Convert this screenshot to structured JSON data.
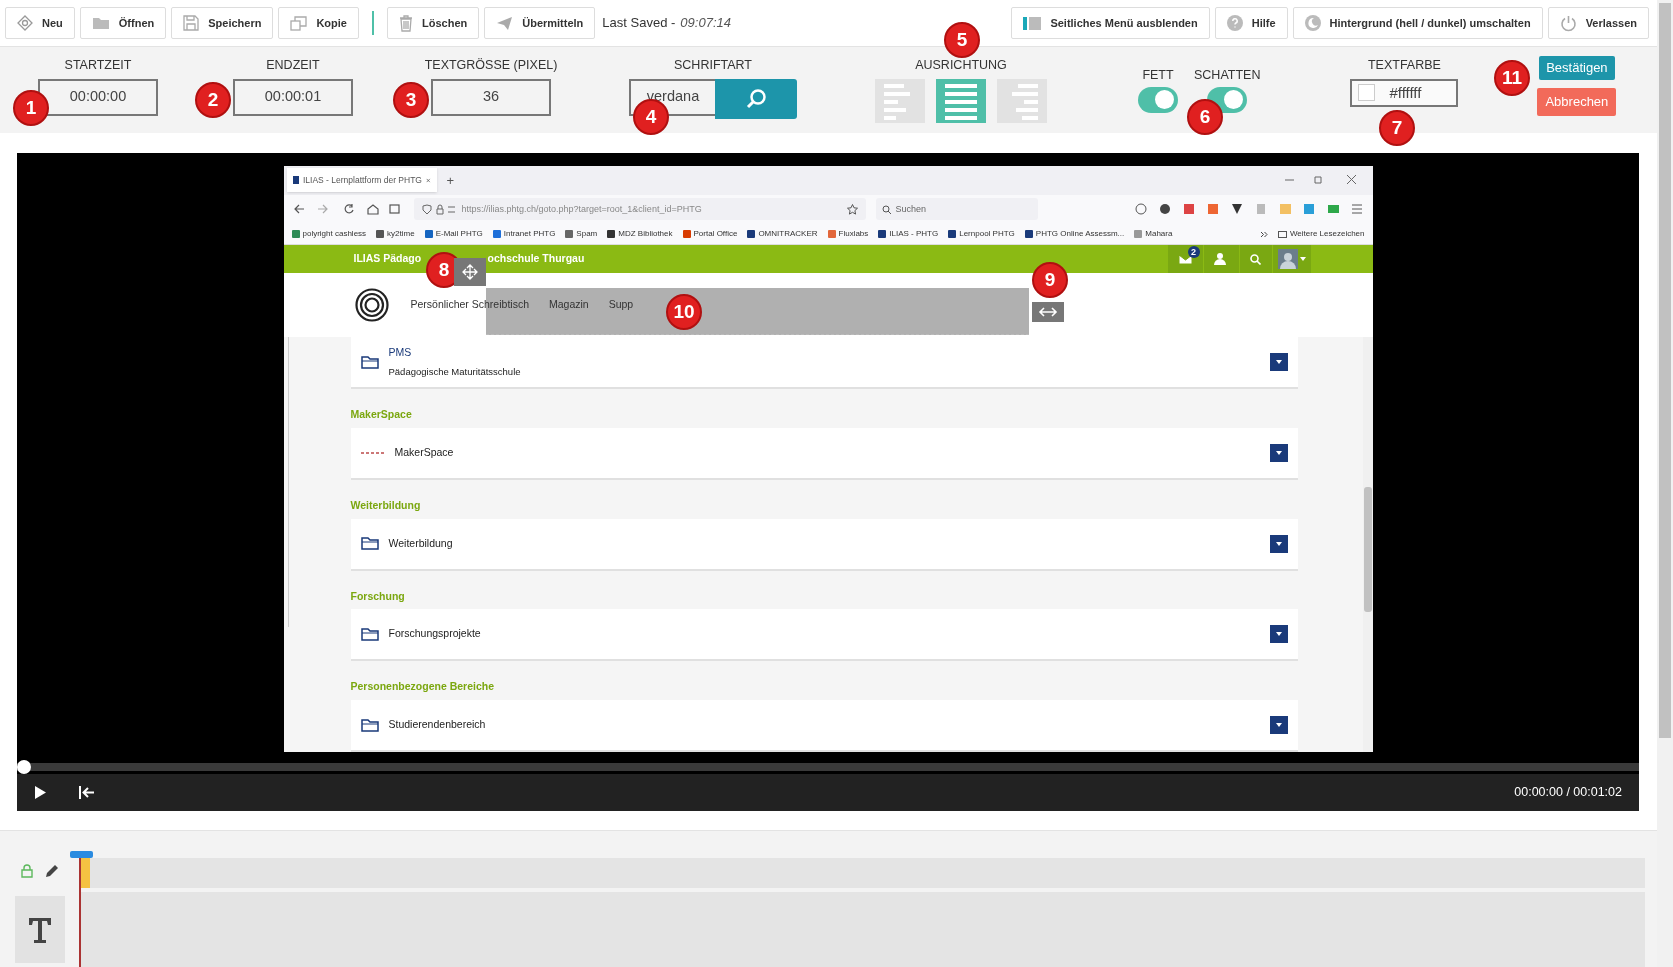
{
  "toolbar": {
    "left_buttons": [
      {
        "label": "Neu"
      },
      {
        "label": "Öffnen"
      },
      {
        "label": "Speichern"
      },
      {
        "label": "Kopie"
      }
    ],
    "edit_buttons": [
      {
        "label": "Löschen"
      },
      {
        "label": "Übermitteln"
      }
    ],
    "last_saved": {
      "label": "Last Saved -",
      "time": "09:07:14"
    },
    "right_buttons": [
      {
        "label": "Seitliches Menü ausblenden"
      },
      {
        "label": "Hilfe"
      },
      {
        "label": "Hintergrund (hell / dunkel) umschalten"
      },
      {
        "label": "Verlassen"
      }
    ]
  },
  "settings": {
    "fields": [
      {
        "label": "STARTZEIT",
        "value": "00:00:00"
      },
      {
        "label": "ENDZEIT",
        "value": "00:00:01"
      },
      {
        "label": "TEXTGRÖSSE (PIXEL)",
        "value": "36"
      }
    ],
    "font": {
      "label": "SCHRIFTART",
      "value": "verdana"
    },
    "alignment": {
      "label": "AUSRICHTUNG",
      "options": [
        {
          "kind": "left",
          "selected": false
        },
        {
          "kind": "justify",
          "selected": true
        },
        {
          "kind": "right",
          "selected": false
        }
      ]
    },
    "toggles": [
      {
        "label": "FETT",
        "on": true
      },
      {
        "label": "SCHATTEN",
        "on": true
      }
    ],
    "text_color": {
      "label": "TEXTFARBE",
      "value": "#ffffff",
      "color": "#ffffff"
    },
    "confirm": "Bestätigen",
    "cancel": "Abbrechen"
  },
  "video": {
    "browser": {
      "tab": "ILIAS - Lernplattform der PHTG",
      "new_tab": "+",
      "url": "https://ilias.phtg.ch/goto.php?target=root_1&client_id=PHTG",
      "search": "Suchen",
      "bookmarks": [
        "polyright cashless",
        "ky2time",
        "E-Mail PHTG",
        "Intranet PHTG",
        "Spam",
        "MDZ Bibliothek",
        "Portal Office",
        "OMNITRACKER",
        "Fluxlabs",
        "ILIAS - PHTG",
        "Lernpool PHTG",
        "PHTG Online Assessm...",
        "Mahara"
      ],
      "more_bookmarks": "Weitere Lesezeichen",
      "site_title": [
        "ILIAS Pädago",
        "ochschule Thurgau"
      ],
      "mail_count": "2",
      "nav": [
        "Persönlicher Schreibtisch",
        "Magazin",
        "Supp"
      ],
      "sections": [
        {
          "items": [
            {
              "title": "PMS",
              "subtitle": "Pädagogische Maturitätsschule"
            }
          ]
        },
        {
          "heading": "MakerSpace",
          "items": [
            {
              "title": "MakerSpace"
            }
          ]
        },
        {
          "heading": "Weiterbildung",
          "items": [
            {
              "title": "Weiterbildung"
            }
          ]
        },
        {
          "heading": "Forschung",
          "items": [
            {
              "title": "Forschungsprojekte"
            }
          ]
        },
        {
          "heading": "Personenbezogene Bereiche",
          "items": [
            {
              "title": "Studierendenbereich"
            }
          ]
        }
      ]
    },
    "player": {
      "level": 0,
      "time": "00:00:00 / 00:01:02"
    }
  },
  "markers": [
    "1",
    "2",
    "3",
    "4",
    "5",
    "6",
    "7",
    "8",
    "9",
    "10",
    "11"
  ]
}
